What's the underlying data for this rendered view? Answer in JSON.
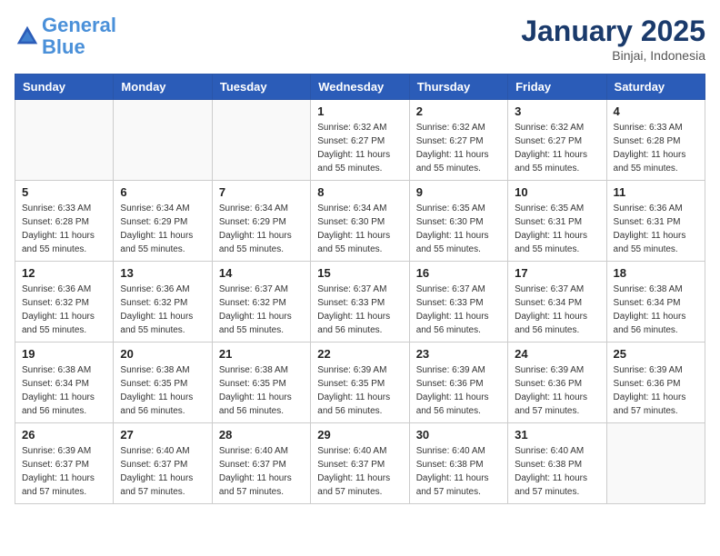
{
  "logo": {
    "text_general": "General",
    "text_blue": "Blue"
  },
  "header": {
    "month": "January 2025",
    "location": "Binjai, Indonesia"
  },
  "days_of_week": [
    "Sunday",
    "Monday",
    "Tuesday",
    "Wednesday",
    "Thursday",
    "Friday",
    "Saturday"
  ],
  "weeks": [
    [
      {
        "day": "",
        "info": ""
      },
      {
        "day": "",
        "info": ""
      },
      {
        "day": "",
        "info": ""
      },
      {
        "day": "1",
        "info": "Sunrise: 6:32 AM\nSunset: 6:27 PM\nDaylight: 11 hours\nand 55 minutes."
      },
      {
        "day": "2",
        "info": "Sunrise: 6:32 AM\nSunset: 6:27 PM\nDaylight: 11 hours\nand 55 minutes."
      },
      {
        "day": "3",
        "info": "Sunrise: 6:32 AM\nSunset: 6:27 PM\nDaylight: 11 hours\nand 55 minutes."
      },
      {
        "day": "4",
        "info": "Sunrise: 6:33 AM\nSunset: 6:28 PM\nDaylight: 11 hours\nand 55 minutes."
      }
    ],
    [
      {
        "day": "5",
        "info": "Sunrise: 6:33 AM\nSunset: 6:28 PM\nDaylight: 11 hours\nand 55 minutes."
      },
      {
        "day": "6",
        "info": "Sunrise: 6:34 AM\nSunset: 6:29 PM\nDaylight: 11 hours\nand 55 minutes."
      },
      {
        "day": "7",
        "info": "Sunrise: 6:34 AM\nSunset: 6:29 PM\nDaylight: 11 hours\nand 55 minutes."
      },
      {
        "day": "8",
        "info": "Sunrise: 6:34 AM\nSunset: 6:30 PM\nDaylight: 11 hours\nand 55 minutes."
      },
      {
        "day": "9",
        "info": "Sunrise: 6:35 AM\nSunset: 6:30 PM\nDaylight: 11 hours\nand 55 minutes."
      },
      {
        "day": "10",
        "info": "Sunrise: 6:35 AM\nSunset: 6:31 PM\nDaylight: 11 hours\nand 55 minutes."
      },
      {
        "day": "11",
        "info": "Sunrise: 6:36 AM\nSunset: 6:31 PM\nDaylight: 11 hours\nand 55 minutes."
      }
    ],
    [
      {
        "day": "12",
        "info": "Sunrise: 6:36 AM\nSunset: 6:32 PM\nDaylight: 11 hours\nand 55 minutes."
      },
      {
        "day": "13",
        "info": "Sunrise: 6:36 AM\nSunset: 6:32 PM\nDaylight: 11 hours\nand 55 minutes."
      },
      {
        "day": "14",
        "info": "Sunrise: 6:37 AM\nSunset: 6:32 PM\nDaylight: 11 hours\nand 55 minutes."
      },
      {
        "day": "15",
        "info": "Sunrise: 6:37 AM\nSunset: 6:33 PM\nDaylight: 11 hours\nand 56 minutes."
      },
      {
        "day": "16",
        "info": "Sunrise: 6:37 AM\nSunset: 6:33 PM\nDaylight: 11 hours\nand 56 minutes."
      },
      {
        "day": "17",
        "info": "Sunrise: 6:37 AM\nSunset: 6:34 PM\nDaylight: 11 hours\nand 56 minutes."
      },
      {
        "day": "18",
        "info": "Sunrise: 6:38 AM\nSunset: 6:34 PM\nDaylight: 11 hours\nand 56 minutes."
      }
    ],
    [
      {
        "day": "19",
        "info": "Sunrise: 6:38 AM\nSunset: 6:34 PM\nDaylight: 11 hours\nand 56 minutes."
      },
      {
        "day": "20",
        "info": "Sunrise: 6:38 AM\nSunset: 6:35 PM\nDaylight: 11 hours\nand 56 minutes."
      },
      {
        "day": "21",
        "info": "Sunrise: 6:38 AM\nSunset: 6:35 PM\nDaylight: 11 hours\nand 56 minutes."
      },
      {
        "day": "22",
        "info": "Sunrise: 6:39 AM\nSunset: 6:35 PM\nDaylight: 11 hours\nand 56 minutes."
      },
      {
        "day": "23",
        "info": "Sunrise: 6:39 AM\nSunset: 6:36 PM\nDaylight: 11 hours\nand 56 minutes."
      },
      {
        "day": "24",
        "info": "Sunrise: 6:39 AM\nSunset: 6:36 PM\nDaylight: 11 hours\nand 57 minutes."
      },
      {
        "day": "25",
        "info": "Sunrise: 6:39 AM\nSunset: 6:36 PM\nDaylight: 11 hours\nand 57 minutes."
      }
    ],
    [
      {
        "day": "26",
        "info": "Sunrise: 6:39 AM\nSunset: 6:37 PM\nDaylight: 11 hours\nand 57 minutes."
      },
      {
        "day": "27",
        "info": "Sunrise: 6:40 AM\nSunset: 6:37 PM\nDaylight: 11 hours\nand 57 minutes."
      },
      {
        "day": "28",
        "info": "Sunrise: 6:40 AM\nSunset: 6:37 PM\nDaylight: 11 hours\nand 57 minutes."
      },
      {
        "day": "29",
        "info": "Sunrise: 6:40 AM\nSunset: 6:37 PM\nDaylight: 11 hours\nand 57 minutes."
      },
      {
        "day": "30",
        "info": "Sunrise: 6:40 AM\nSunset: 6:38 PM\nDaylight: 11 hours\nand 57 minutes."
      },
      {
        "day": "31",
        "info": "Sunrise: 6:40 AM\nSunset: 6:38 PM\nDaylight: 11 hours\nand 57 minutes."
      },
      {
        "day": "",
        "info": ""
      }
    ]
  ]
}
